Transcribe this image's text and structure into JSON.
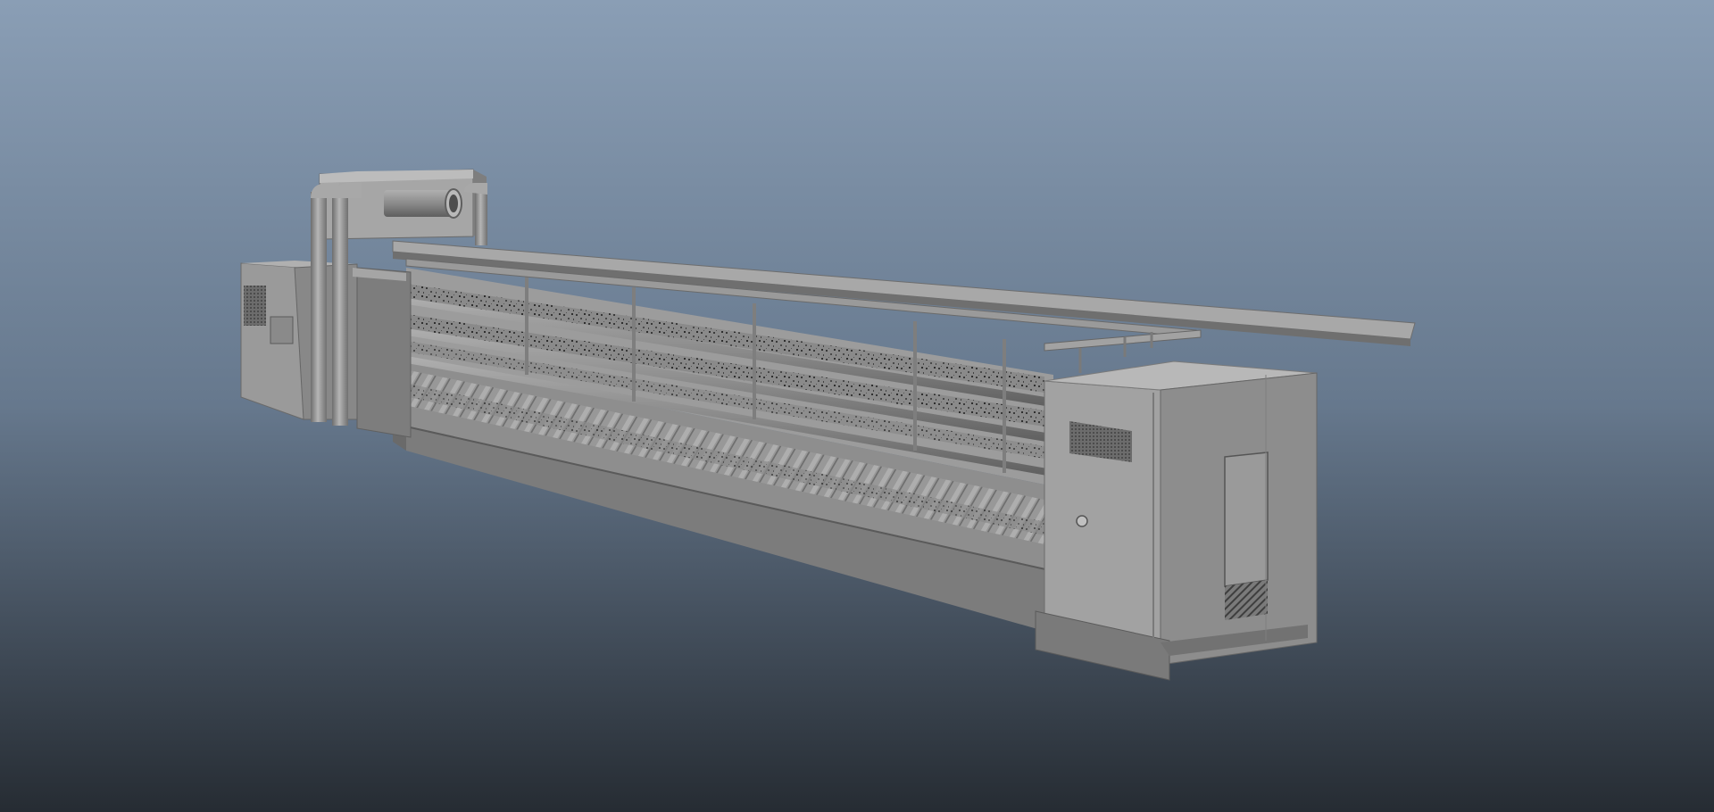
{
  "viewport": {
    "background_top": "#8a9eb5",
    "background_bottom": "#262c33",
    "shading": "untextured grey",
    "model_color": "#8f8f8f"
  },
  "scene": {
    "object": "textile-spinning-machine",
    "parts": [
      "headstock-cabinet",
      "duct-housing",
      "duct-pipe",
      "creel-rail",
      "roving-bobbin-row",
      "drafting-roller",
      "spindle-rail",
      "end-cabinet",
      "vent-grille",
      "access-door"
    ]
  }
}
